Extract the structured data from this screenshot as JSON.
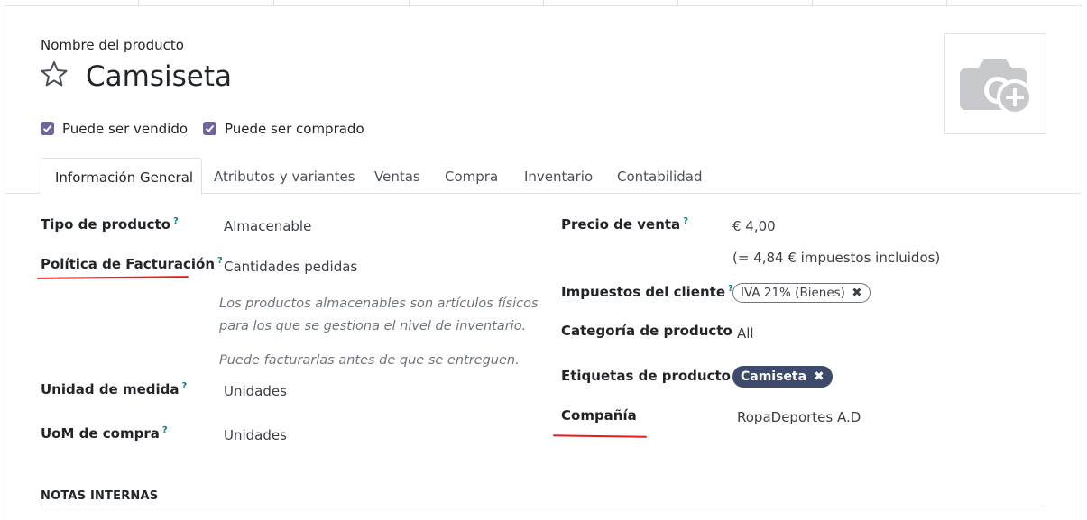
{
  "product": {
    "name_label": "Nombre del producto",
    "name": "Camsiseta",
    "can_be_sold_label": "Puede ser vendido",
    "can_be_purchased_label": "Puede ser comprado",
    "can_be_sold": true,
    "can_be_purchased": true
  },
  "tabs": [
    {
      "label": "Información General",
      "active": true
    },
    {
      "label": "Atributos y variantes"
    },
    {
      "label": "Ventas"
    },
    {
      "label": "Compra"
    },
    {
      "label": "Inventario"
    },
    {
      "label": "Contabilidad"
    }
  ],
  "left_fields": {
    "product_type": {
      "label": "Tipo de producto",
      "help": "?",
      "value": "Almacenable"
    },
    "invoice_policy": {
      "label": "Política de Facturación",
      "help": "?",
      "value": "Cantidades pedidas"
    },
    "storable_note_1": "Los productos almacenables son artículos físicos",
    "storable_note_2": "para los que se gestiona el nivel de inventario.",
    "invoice_note": "Puede facturarlas antes de que se entreguen.",
    "uom": {
      "label": "Unidad de medida",
      "help": "?",
      "value": "Unidades"
    },
    "purchase_uom": {
      "label": "UoM de compra",
      "help": "?",
      "value": "Unidades"
    }
  },
  "right_fields": {
    "sales_price": {
      "label": "Precio de venta",
      "help": "?",
      "value": "€ 4,00",
      "tax_included": "(= 4,84 € impuestos incluidos)"
    },
    "customer_taxes": {
      "label": "Impuestos del cliente",
      "help": "?",
      "tag": "IVA 21% (Bienes)"
    },
    "category": {
      "label": "Categoría de producto",
      "value": "All"
    },
    "tags": {
      "label": "Etiquetas de producto",
      "tag": "Camiseta"
    },
    "company": {
      "label": "Compañía",
      "value": "RopaDeportes A.D"
    }
  },
  "section": {
    "internal_notes": "NOTAS INTERNAS"
  },
  "colors": {
    "accent": "#71639e",
    "help": "#017e84",
    "tag_bg": "#3d4a6b",
    "annotation": "#e02020"
  },
  "icons": {
    "favorite": "star-outline-icon",
    "image": "camera-plus-icon"
  }
}
